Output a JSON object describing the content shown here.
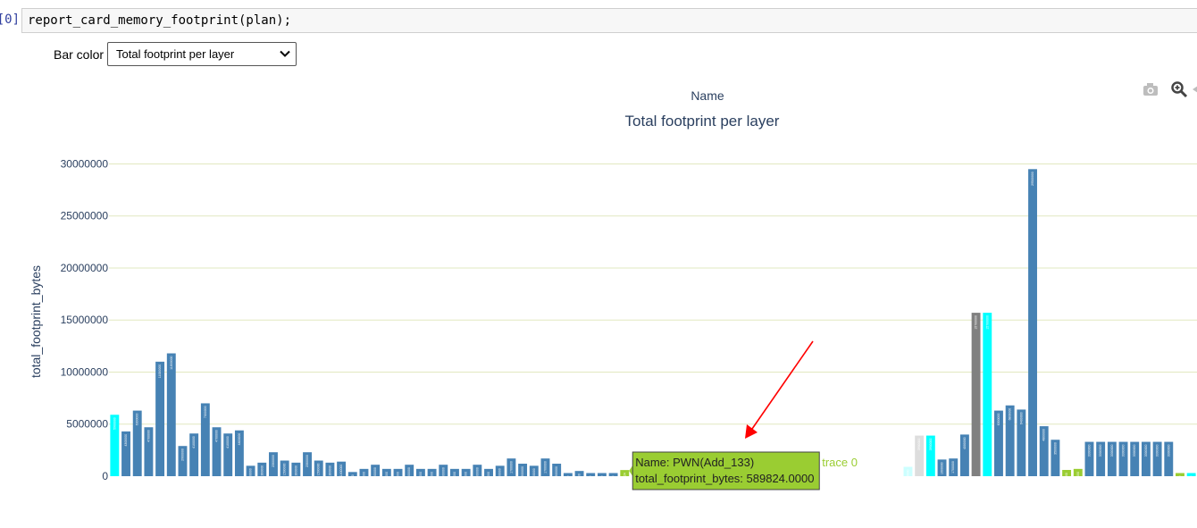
{
  "notebook": {
    "prompt": "[0]:",
    "code": "report_card_memory_footprint(plan);"
  },
  "controls": {
    "bar_color_label": "Bar color",
    "bar_color_value": "Total footprint per layer"
  },
  "modebar": {
    "icons": [
      "camera-icon",
      "zoom-icon",
      "pan-icon"
    ]
  },
  "chart_data": {
    "type": "bar",
    "header": "Name",
    "title": "Total footprint per layer",
    "xlabel": "",
    "ylabel": "total_footprint_bytes",
    "ylim": [
      0,
      31500000
    ],
    "yticks": [
      0,
      5000000,
      10000000,
      15000000,
      20000000,
      25000000,
      30000000
    ],
    "ytick_labels": [
      "0",
      "5000000",
      "10000000",
      "15000000",
      "20000000",
      "25000000",
      "30000000"
    ],
    "grid": true,
    "colors": {
      "steelblue": "#4682b4",
      "cyan": "#00ffff",
      "green": "#9acd32",
      "gray": "#808080",
      "pale_cyan": "#ccffff",
      "light_gray": "#dddddd"
    },
    "values": [
      5900000,
      4300000,
      6300000,
      4700000,
      11000000,
      11800000,
      2900000,
      4100000,
      7000000,
      4700000,
      4100000,
      4400000,
      1000000,
      1300000,
      2300000,
      1500000,
      1300000,
      2300000,
      1500000,
      1300000,
      1400000,
      400000,
      700000,
      1100000,
      700000,
      700000,
      1100000,
      700000,
      700000,
      1100000,
      700000,
      700000,
      1100000,
      700000,
      1000000,
      1700000,
      1200000,
      1000000,
      1700000,
      1200000,
      300000,
      500000,
      300000,
      300000,
      300000,
      589824,
      0,
      0,
      0,
      0,
      0,
      0,
      0,
      0,
      0,
      0,
      0,
      0,
      0,
      0,
      0,
      0,
      0,
      0,
      0,
      0,
      0,
      0,
      0,
      0,
      900000,
      3900000,
      3900000,
      1600000,
      1700000,
      4000000,
      15700000,
      15700000,
      6300000,
      6800000,
      6400000,
      29500000,
      4800000,
      3500000,
      600000,
      700000,
      3300000,
      3300000,
      3300000,
      3300000,
      3300000,
      3300000,
      3300000,
      3300000,
      300000,
      300000
    ],
    "bar_colors": [
      "cyan",
      "steelblue",
      "steelblue",
      "steelblue",
      "steelblue",
      "steelblue",
      "steelblue",
      "steelblue",
      "steelblue",
      "steelblue",
      "steelblue",
      "steelblue",
      "steelblue",
      "steelblue",
      "steelblue",
      "steelblue",
      "steelblue",
      "steelblue",
      "steelblue",
      "steelblue",
      "steelblue",
      "steelblue",
      "steelblue",
      "steelblue",
      "steelblue",
      "steelblue",
      "steelblue",
      "steelblue",
      "steelblue",
      "steelblue",
      "steelblue",
      "steelblue",
      "steelblue",
      "steelblue",
      "steelblue",
      "steelblue",
      "steelblue",
      "steelblue",
      "steelblue",
      "steelblue",
      "steelblue",
      "steelblue",
      "steelblue",
      "steelblue",
      "steelblue",
      "green",
      "steelblue",
      "steelblue",
      "steelblue",
      "steelblue",
      "steelblue",
      "steelblue",
      "steelblue",
      "steelblue",
      "steelblue",
      "steelblue",
      "steelblue",
      "steelblue",
      "steelblue",
      "steelblue",
      "steelblue",
      "steelblue",
      "steelblue",
      "steelblue",
      "steelblue",
      "steelblue",
      "steelblue",
      "steelblue",
      "steelblue",
      "steelblue",
      "pale_cyan",
      "light_gray",
      "cyan",
      "steelblue",
      "steelblue",
      "steelblue",
      "gray",
      "cyan",
      "steelblue",
      "steelblue",
      "steelblue",
      "steelblue",
      "steelblue",
      "steelblue",
      "green",
      "green",
      "steelblue",
      "steelblue",
      "steelblue",
      "steelblue",
      "steelblue",
      "steelblue",
      "steelblue",
      "steelblue",
      "green",
      "cyan"
    ],
    "hover": {
      "name_label": "Name: PWN(Add_133)",
      "value_label": "total_footprint_bytes: 589824.0000",
      "bar_index": 45,
      "trace_label": "trace 0",
      "color": "#9acd32"
    },
    "annotation": {
      "type": "arrow",
      "color": "#ff0000"
    }
  }
}
